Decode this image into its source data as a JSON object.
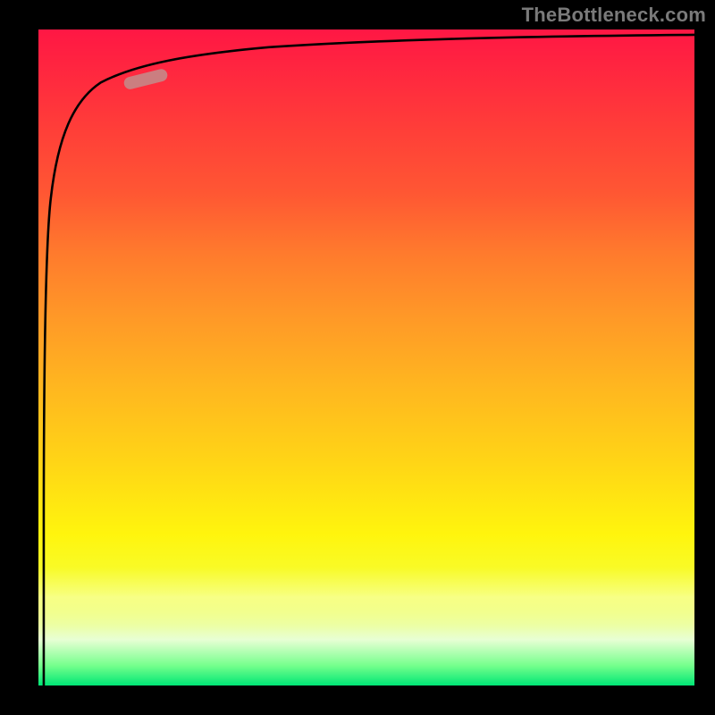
{
  "watermark": "TheBottleneck.com",
  "chart_data": {
    "type": "line",
    "title": "",
    "xlabel": "",
    "ylabel": "",
    "xlim": [
      0,
      100
    ],
    "ylim": [
      0,
      100
    ],
    "background_gradient": {
      "orientation": "vertical",
      "stops": [
        {
          "pos": 0.0,
          "color": "#ff1744"
        },
        {
          "pos": 0.25,
          "color": "#ff5733"
        },
        {
          "pos": 0.55,
          "color": "#ffb81f"
        },
        {
          "pos": 0.85,
          "color": "#f4ff3a"
        },
        {
          "pos": 1.0,
          "color": "#00e676"
        }
      ]
    },
    "series": [
      {
        "name": "curve",
        "x": [
          0.5,
          0.7,
          1.0,
          1.5,
          3,
          6,
          12,
          25,
          50,
          75,
          100
        ],
        "y": [
          0,
          20,
          60,
          80,
          89,
          92,
          94,
          96,
          97.5,
          98.5,
          99
        ]
      }
    ],
    "highlight_segment": {
      "series": "curve",
      "x_start": 13,
      "x_end": 19,
      "color": "#c78585"
    }
  }
}
